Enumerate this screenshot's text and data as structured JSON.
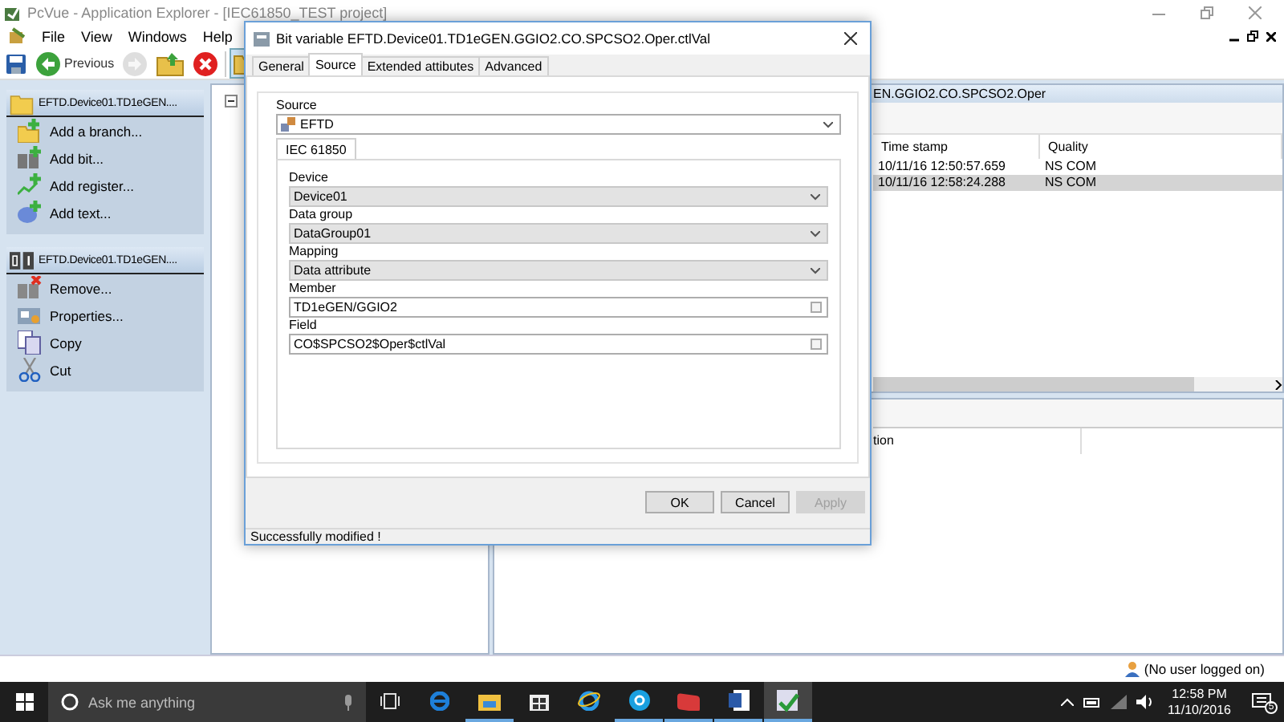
{
  "window": {
    "title": "PcVue - Application Explorer - [IEC61850_TEST project]"
  },
  "menu": [
    {
      "label": "File"
    },
    {
      "label": "View"
    },
    {
      "label": "Windows"
    },
    {
      "label": "Help"
    }
  ],
  "toolbar": [
    {
      "kind": "save",
      "pressed": false,
      "disabled": false
    },
    {
      "kind": "back",
      "label": "Previous",
      "pressed": false,
      "disabled": false
    },
    {
      "kind": "forward",
      "pressed": false,
      "disabled": true
    },
    {
      "kind": "up",
      "pressed": false,
      "disabled": false
    },
    {
      "kind": "stop",
      "pressed": false,
      "disabled": false
    },
    {
      "kind": "folders",
      "pressed": true,
      "disabled": false
    }
  ],
  "sidebar": {
    "panels": [
      {
        "kind": "branch",
        "title": "EFTD.Device01.TD1eGEN....",
        "items": [
          {
            "kind": "add-branch",
            "label": "Add a branch..."
          },
          {
            "kind": "add-bit",
            "label": "Add bit..."
          },
          {
            "kind": "add-register",
            "label": "Add register..."
          },
          {
            "kind": "add-text",
            "label": "Add text..."
          }
        ]
      },
      {
        "kind": "bit",
        "title": "EFTD.Device01.TD1eGEN....",
        "items": [
          {
            "kind": "remove",
            "label": "Remove..."
          },
          {
            "kind": "properties",
            "label": "Properties..."
          },
          {
            "kind": "copy",
            "label": "Copy"
          },
          {
            "kind": "cut",
            "label": "Cut"
          }
        ]
      }
    ]
  },
  "right_pane": {
    "header": "EN.GGIO2.CO.SPCSO2.Oper",
    "table": {
      "columns": [
        "Time stamp",
        "Quality"
      ],
      "rows": [
        {
          "cells": [
            "10/11/16 12:50:57.659",
            "NS COM"
          ],
          "selected": false
        },
        {
          "cells": [
            "10/11/16 12:58:24.288",
            "NS COM"
          ],
          "selected": true
        }
      ]
    },
    "bottom_table": {
      "columns": [
        "tion"
      ]
    }
  },
  "status_bar": {
    "user": "(No user logged on)"
  },
  "dialog": {
    "title": "Bit variable EFTD.Device01.TD1eGEN.GGIO2.CO.SPCSO2.Oper.ctlVal",
    "tabs": [
      {
        "label": "General",
        "selected": false
      },
      {
        "label": "Source",
        "selected": true
      },
      {
        "label": "Extended attibutes",
        "selected": false
      },
      {
        "label": "Advanced",
        "selected": false
      }
    ],
    "source": {
      "label": "Source",
      "value": "EFTD"
    },
    "inner_tabs": [
      {
        "label": "IEC 61850",
        "selected": true
      }
    ],
    "fields": [
      {
        "kind": "dropdown",
        "label": "Device",
        "value": "Device01"
      },
      {
        "kind": "dropdown",
        "label": "Data group",
        "value": "DataGroup01"
      },
      {
        "kind": "dropdown",
        "label": "Mapping",
        "value": "Data attribute"
      },
      {
        "kind": "text",
        "label": "Member",
        "value": "TD1eGEN/GGIO2"
      },
      {
        "kind": "text",
        "label": "Field",
        "value": "CO$SPCSO2$Oper$ctlVal"
      }
    ],
    "buttons": [
      {
        "label": "OK",
        "disabled": false
      },
      {
        "label": "Cancel",
        "disabled": false
      },
      {
        "label": "Apply",
        "disabled": true
      }
    ],
    "status": "Successfully modified !"
  },
  "taskbar": {
    "search_placeholder": "Ask me anything",
    "apps": [
      {
        "kind": "task-view",
        "running": false,
        "active": false
      },
      {
        "kind": "edge",
        "running": false,
        "active": false
      },
      {
        "kind": "explorer",
        "running": true,
        "active": false
      },
      {
        "kind": "store",
        "running": false,
        "active": false
      },
      {
        "kind": "ie",
        "running": false,
        "active": false
      },
      {
        "kind": "skype",
        "running": true,
        "active": false
      },
      {
        "kind": "red-app",
        "running": true,
        "active": false
      },
      {
        "kind": "word",
        "running": true,
        "active": false
      },
      {
        "kind": "pcvue",
        "running": true,
        "active": true
      }
    ],
    "clock": {
      "time": "12:58 PM",
      "date": "11/10/2016"
    },
    "notifications": "5"
  }
}
